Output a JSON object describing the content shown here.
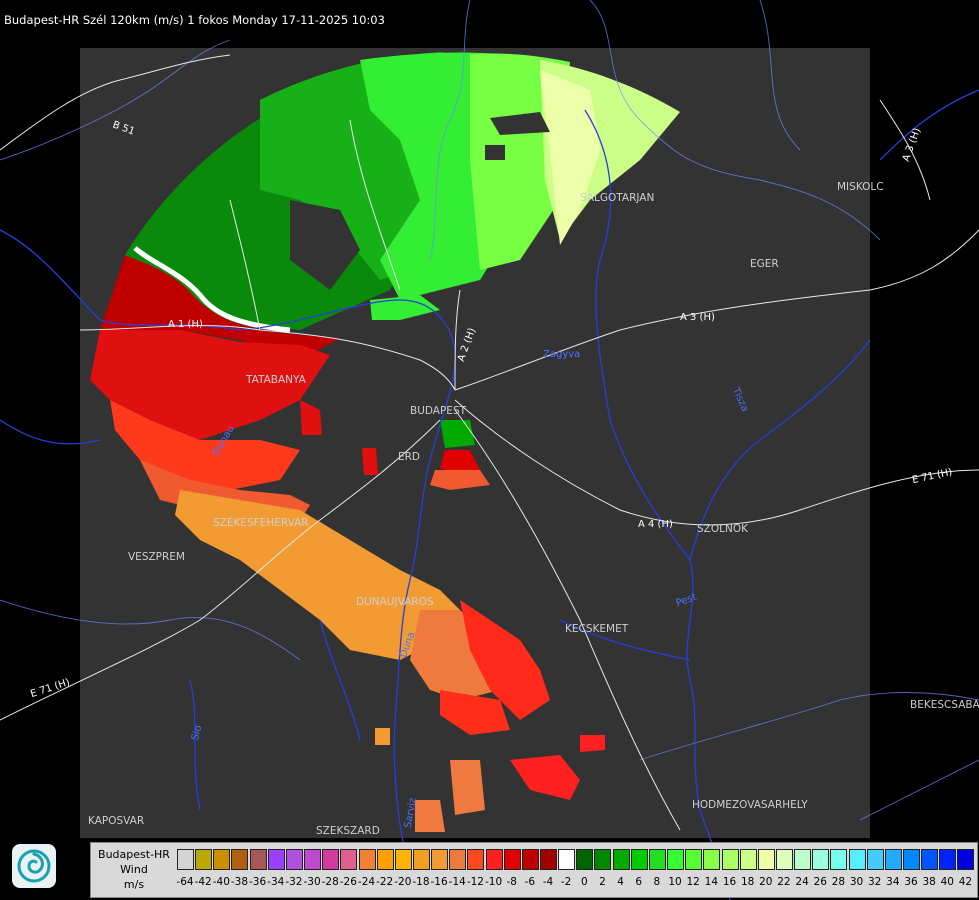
{
  "title": "Budapest-HR Szél 120km (m/s) 1 fokos Monday 17-11-2025 10:03",
  "cities": [
    {
      "name": "TATABANYA",
      "key": "tatabanya"
    },
    {
      "name": "BUDAPEST",
      "key": "budapest"
    },
    {
      "name": "ERD",
      "key": "erd"
    },
    {
      "name": "SZEKESFEHERVAR",
      "key": "szekesfehervar"
    },
    {
      "name": "VESZPREM",
      "key": "veszprem"
    },
    {
      "name": "DUNAUJVAROS",
      "key": "dunaujvaros"
    },
    {
      "name": "KECSKEMET",
      "key": "kecskemet"
    },
    {
      "name": "SZOLNOK",
      "key": "szolnok"
    },
    {
      "name": "EGER",
      "key": "eger"
    },
    {
      "name": "SALGOTARJAN",
      "key": "salgotarjan"
    },
    {
      "name": "MISKOLC",
      "key": "miskolc"
    },
    {
      "name": "BEKESCSABA",
      "key": "bekescsaba"
    },
    {
      "name": "HODMEZOVASARHELY",
      "key": "hodmezovasarhely"
    },
    {
      "name": "KAPOSVAR",
      "key": "kaposvar"
    },
    {
      "name": "SZEKSZARD",
      "key": "szekszard"
    }
  ],
  "roads": [
    {
      "name": "A 3 (H)",
      "key": "a3"
    },
    {
      "name": "A 4 (H)",
      "key": "a4"
    },
    {
      "name": "E 71 (H)",
      "key": "e71"
    },
    {
      "name": "E 71 (H)",
      "key": "e71b"
    },
    {
      "name": "B 51",
      "key": "b51"
    },
    {
      "name": "A 1 (H)",
      "key": "a1"
    },
    {
      "name": "A 2 (H)",
      "key": "a2"
    },
    {
      "name": "A 3 (H)",
      "key": "a3ne"
    }
  ],
  "rivers": [
    {
      "name": "Duna",
      "key": "duna"
    },
    {
      "name": "Tisza",
      "key": "tisza"
    },
    {
      "name": "Sio",
      "key": "sio"
    },
    {
      "name": "Pest",
      "key": "pest"
    },
    {
      "name": "Zagyva",
      "key": "zagyva"
    },
    {
      "name": "Sarviz",
      "key": "sarviz"
    },
    {
      "name": "Donau",
      "key": "donau"
    }
  ],
  "legend": {
    "line1": "Budapest-HR",
    "line2": "Wind",
    "unit": "m/s",
    "labels": [
      "-64",
      "-42",
      "-40",
      "-38",
      "-36",
      "-34",
      "-32",
      "-30",
      "-28",
      "-26",
      "-24",
      "-22",
      "-20",
      "-18",
      "-16",
      "-14",
      "-12",
      "-10",
      "-8",
      "-6",
      "-4",
      "-2",
      "0",
      "2",
      "4",
      "6",
      "8",
      "10",
      "12",
      "14",
      "16",
      "18",
      "20",
      "22",
      "24",
      "26",
      "28",
      "30",
      "32",
      "34",
      "36",
      "38",
      "40",
      "42"
    ],
    "colors": [
      "#d4d4d4",
      "#b9a900",
      "#c89000",
      "#b05e10",
      "#a45757",
      "#9a40ff",
      "#b050e0",
      "#c048d0",
      "#d03c9e",
      "#e05f8e",
      "#ef8034",
      "#ff9f00",
      "#ffb400",
      "#f0a020",
      "#f29b33",
      "#ee7a3f",
      "#ff4a20",
      "#ff2020",
      "#e00000",
      "#c00000",
      "#a00000",
      "#ffffff",
      "#006400",
      "#008800",
      "#00aa00",
      "#00cc00",
      "#22dd22",
      "#33ff33",
      "#55ff33",
      "#88ff44",
      "#aaff66",
      "#ccff88",
      "#eeffaa",
      "#ddffbb",
      "#bbffcc",
      "#99ffdd",
      "#77ffee",
      "#55eeff",
      "#44ccff",
      "#22aaff",
      "#0088ff",
      "#0055ff",
      "#0022ff",
      "#0000dd"
    ]
  }
}
